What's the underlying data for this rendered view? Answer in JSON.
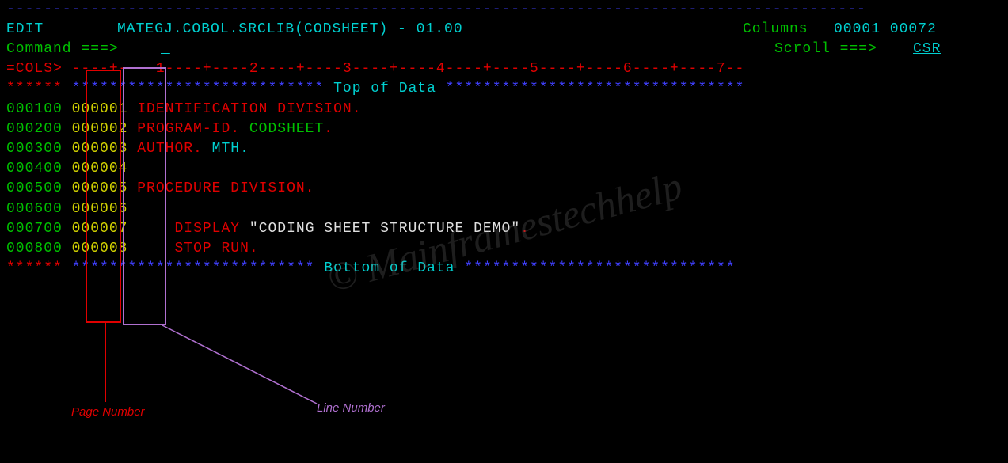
{
  "header": {
    "mode": "EDIT",
    "dataset": "MATEGJ.COBOL.SRCLIB(CODSHEET) - 01.00",
    "columns_label": "Columns",
    "columns_value": "00001 00072",
    "command_label": "Command ===>",
    "scroll_label": "Scroll ===>",
    "scroll_value": "CSR"
  },
  "ruler": "=COLS> ----+----1----+----2----+----3----+----4----+----5----+----6----+----7--",
  "top_data_label": "Top of Data",
  "bottom_data_label": "Bottom of Data",
  "lines": [
    {
      "seq": "000100",
      "lnum": "000001",
      "text_parts": [
        {
          "cls": "red",
          "t": "IDENTIFICATION DIVISION."
        }
      ]
    },
    {
      "seq": "000200",
      "lnum": "000002",
      "text_parts": [
        {
          "cls": "red",
          "t": "PROGRAM-ID. "
        },
        {
          "cls": "green",
          "t": "CODSHEET"
        },
        {
          "cls": "red",
          "t": "."
        }
      ]
    },
    {
      "seq": "000300",
      "lnum": "000003",
      "text_parts": [
        {
          "cls": "red",
          "t": "AUTHOR. "
        },
        {
          "cls": "cyan",
          "t": "MTH."
        }
      ]
    },
    {
      "seq": "000400",
      "lnum": "000004",
      "text_parts": []
    },
    {
      "seq": "000500",
      "lnum": "000005",
      "text_parts": [
        {
          "cls": "red",
          "t": "PROCEDURE DIVISION."
        }
      ]
    },
    {
      "seq": "000600",
      "lnum": "000006",
      "text_parts": []
    },
    {
      "seq": "000700",
      "lnum": "000007",
      "text_parts": [
        {
          "cls": "blank",
          "t": "    "
        },
        {
          "cls": "red",
          "t": "DISPLAY "
        },
        {
          "cls": "white",
          "t": "\"CODING SHEET STRUCTURE DEMO\""
        },
        {
          "cls": "red",
          "t": "."
        }
      ]
    },
    {
      "seq": "000800",
      "lnum": "000008",
      "text_parts": [
        {
          "cls": "blank",
          "t": "    "
        },
        {
          "cls": "red",
          "t": "STOP RUN."
        }
      ]
    }
  ],
  "annotations": {
    "page_number": "Page Number",
    "line_number": "Line Number"
  }
}
